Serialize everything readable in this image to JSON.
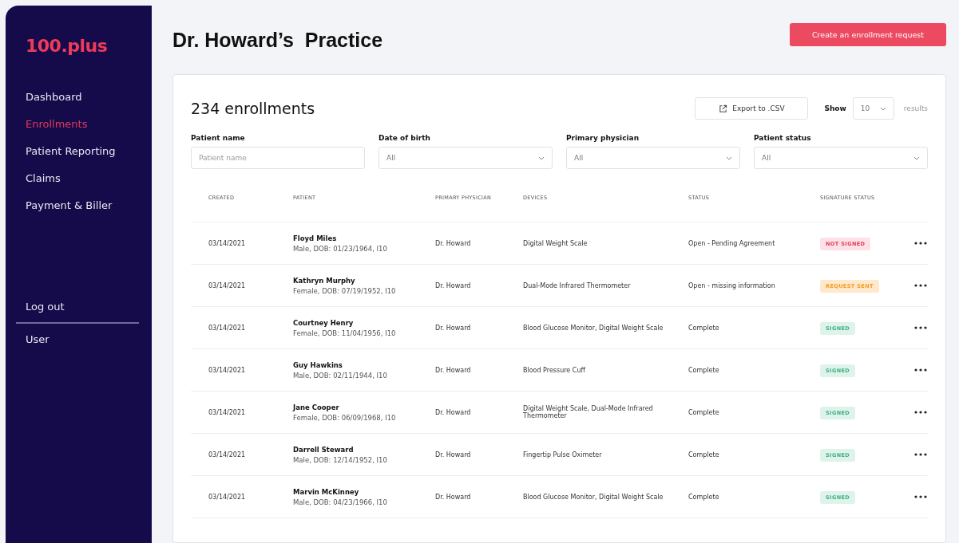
{
  "sidebar": {
    "logo": "100.plus",
    "items": [
      {
        "label": "Dashboard",
        "selected": false
      },
      {
        "label": "Enrollments",
        "selected": true
      },
      {
        "label": "Patient Reporting",
        "selected": false
      },
      {
        "label": "Claims",
        "selected": false
      },
      {
        "label": "Payment & Biller",
        "selected": false
      }
    ],
    "footer_items": [
      "Log out",
      "User"
    ]
  },
  "header": {
    "title": "Dr. Howard’s  Practice",
    "primary_button": "Create an enrollment request"
  },
  "card": {
    "count": "234 enrollments",
    "export_button": "Export to .CSV",
    "show_label": "Show",
    "show_value": "10",
    "results_label": "results",
    "filters": [
      {
        "label": "Patient name",
        "kind": "text",
        "placeholder": "Patient name"
      },
      {
        "label": "Date of birth",
        "kind": "select",
        "value": "All"
      },
      {
        "label": "Primary physician",
        "kind": "select",
        "value": "All"
      },
      {
        "label": "Patient status",
        "kind": "select",
        "value": "All"
      }
    ]
  },
  "table": {
    "columns": [
      "CREATED",
      "PATIENT",
      "PRIMARY PHYSICIAN",
      "DEVICES",
      "STATUS",
      "SIGNATURE STATUS"
    ],
    "rows": [
      {
        "created": "03/14/2021",
        "name": "Floyd Miles",
        "details": "Male, DOB: 01/23/1964, I10",
        "physician": "Dr. Howard",
        "devices": "Digital Weight Scale",
        "status": "Open - Pending Agreement",
        "signature": {
          "label": "NOT SIGNED",
          "kind": "not_signed"
        }
      },
      {
        "created": "03/14/2021",
        "name": "Kathryn Murphy",
        "details": "Female, DOB: 07/19/1952, I10",
        "physician": "Dr. Howard",
        "devices": "Dual-Mode Infrared Thermometer",
        "status": "Open - missing information",
        "signature": {
          "label": "REQUEST SENT",
          "kind": "request_sent"
        }
      },
      {
        "created": "03/14/2021",
        "name": "Courtney Henry",
        "details": "Female, DOB: 11/04/1956, I10",
        "physician": "Dr. Howard",
        "devices": "Blood Glucose Monitor, Digital Weight Scale",
        "status": "Complete",
        "signature": {
          "label": "SIGNED",
          "kind": "signed"
        }
      },
      {
        "created": "03/14/2021",
        "name": "Guy Hawkins",
        "details": "Male, DOB: 02/11/1944, I10",
        "physician": "Dr. Howard",
        "devices": "Blood Pressure Cuff",
        "status": "Complete",
        "signature": {
          "label": "SIGNED",
          "kind": "signed"
        }
      },
      {
        "created": "03/14/2021",
        "name": "Jane Cooper",
        "details": "Female, DOB: 06/09/1968, I10",
        "physician": "Dr. Howard",
        "devices": "Digital Weight Scale, Dual-Mode Infrared Thermometer",
        "status": "Complete",
        "signature": {
          "label": "SIGNED",
          "kind": "signed"
        }
      },
      {
        "created": "03/14/2021",
        "name": "Darrell Steward",
        "details": "Male, DOB: 12/14/1952, I10",
        "physician": "Dr. Howard",
        "devices": "Fingertip Pulse Oximeter",
        "status": "Complete",
        "signature": {
          "label": "SIGNED",
          "kind": "signed"
        }
      },
      {
        "created": "03/14/2021",
        "name": "Marvin McKinney",
        "details": "Male, DOB: 04/23/1966, I10",
        "physician": "Dr. Howard",
        "devices": "Blood Glucose Monitor, Digital Weight Scale",
        "status": "Complete",
        "signature": {
          "label": "SIGNED",
          "kind": "signed"
        }
      }
    ]
  }
}
